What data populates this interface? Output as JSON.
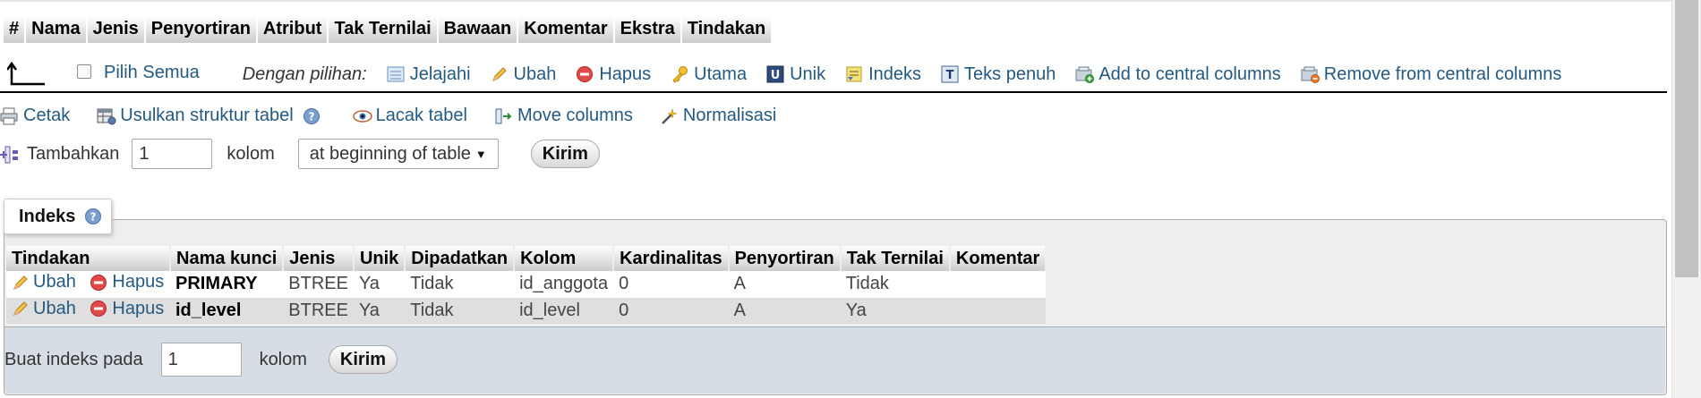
{
  "structure_headers": [
    "#",
    "Nama",
    "Jenis",
    "Penyortiran",
    "Atribut",
    "Tak Ternilai",
    "Bawaan",
    "Komentar",
    "Ekstra",
    "Tindakan"
  ],
  "with_selected": {
    "select_all": "Pilih Semua",
    "label": "Dengan pilihan:",
    "actions": [
      {
        "label": "Jelajahi",
        "icon": "browse-icon"
      },
      {
        "label": "Ubah",
        "icon": "pencil-icon"
      },
      {
        "label": "Hapus",
        "icon": "delete-icon"
      },
      {
        "label": "Utama",
        "icon": "key-icon"
      },
      {
        "label": "Unik",
        "icon": "unique-icon"
      },
      {
        "label": "Indeks",
        "icon": "index-icon"
      },
      {
        "label": "Teks penuh",
        "icon": "fulltext-icon"
      },
      {
        "label": "Add to central columns",
        "icon": "add-central-icon"
      },
      {
        "label": "Remove from central columns",
        "icon": "remove-central-icon"
      }
    ]
  },
  "tools": {
    "print": "Cetak",
    "propose": "Usulkan struktur tabel",
    "track": "Lacak tabel",
    "move": "Move columns",
    "normalize": "Normalisasi"
  },
  "add_columns": {
    "label": "Tambahkan",
    "count": "1",
    "unit": "kolom",
    "position": "at beginning of table",
    "submit": "Kirim"
  },
  "indexes": {
    "title": "Indeks",
    "headers": [
      "Tindakan",
      "Nama kunci",
      "Jenis",
      "Unik",
      "Dipadatkan",
      "Kolom",
      "Kardinalitas",
      "Penyortiran",
      "Tak Ternilai",
      "Komentar"
    ],
    "rows": [
      {
        "edit": "Ubah",
        "delete": "Hapus",
        "key": "PRIMARY",
        "type": "BTREE",
        "unique": "Ya",
        "packed": "Tidak",
        "column": "id_anggota",
        "cardinality": "0",
        "collation": "A",
        "null": "Tidak",
        "comment": ""
      },
      {
        "edit": "Ubah",
        "delete": "Hapus",
        "key": "id_level",
        "type": "BTREE",
        "unique": "Ya",
        "packed": "Tidak",
        "column": "id_level",
        "cardinality": "0",
        "collation": "A",
        "null": "Ya",
        "comment": ""
      }
    ],
    "create": {
      "label": "Buat indeks pada",
      "count": "1",
      "unit": "kolom",
      "submit": "Kirim"
    }
  },
  "colors": {
    "link": "#235a81",
    "footer": "#d6dde5",
    "panel": "#eeeeee"
  }
}
